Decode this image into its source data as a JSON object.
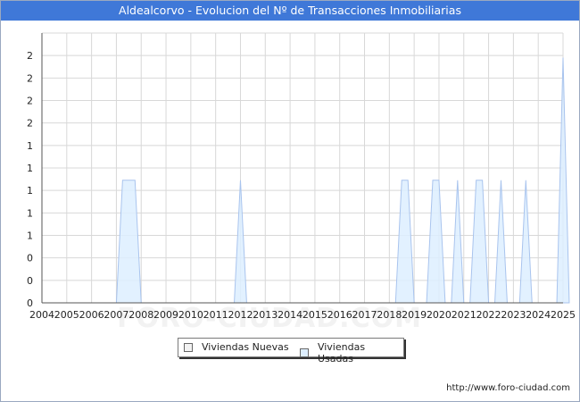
{
  "title": "Aldealcorvo - Evolucion del Nº de Transacciones Inmobiliarias",
  "footer_url": "http://www.foro-ciudad.com",
  "watermark": "FORO-CIUDAD.COM",
  "colors": {
    "title_bg": "#3f78d8",
    "nuevas_fill": "#f2f2f2",
    "usadas_fill": "#ddeeff",
    "usadas_line": "#a9c4ee",
    "grid": "#d8d8d8"
  },
  "chart_data": {
    "type": "area",
    "title": "Aldealcorvo - Evolucion del Nº de Transacciones Inmobiliarias",
    "xlabel": "",
    "ylabel": "",
    "xlim": [
      2004,
      2025
    ],
    "ylim": [
      0,
      2.2
    ],
    "x_ticks": [
      "2004",
      "2005",
      "2006",
      "2007",
      "2008",
      "2009",
      "2010",
      "2011",
      "2012",
      "2013",
      "2014",
      "2015",
      "2016",
      "2017",
      "2018",
      "2019",
      "2020",
      "2021",
      "2022",
      "2023",
      "2024",
      "2025"
    ],
    "y_tick_labels": [
      "0",
      "0",
      "0",
      "1",
      "1",
      "1",
      "1",
      "1",
      "2",
      "2",
      "2",
      "2"
    ],
    "legend_position": "bottom-center",
    "grid": true,
    "series": [
      {
        "name": "Viviendas Nuevas",
        "points": []
      },
      {
        "name": "Viviendas Usadas",
        "points": [
          [
            2007.0,
            0
          ],
          [
            2007.25,
            1
          ],
          [
            2007.75,
            1
          ],
          [
            2008.0,
            0
          ],
          [
            2011.75,
            0
          ],
          [
            2012.0,
            1
          ],
          [
            2012.25,
            0
          ],
          [
            2018.25,
            0
          ],
          [
            2018.5,
            1
          ],
          [
            2018.75,
            1
          ],
          [
            2019.0,
            0
          ],
          [
            2019.5,
            0
          ],
          [
            2019.75,
            1
          ],
          [
            2020.0,
            1
          ],
          [
            2020.25,
            0
          ],
          [
            2020.5,
            0
          ],
          [
            2020.75,
            1
          ],
          [
            2021.0,
            0
          ],
          [
            2021.25,
            0
          ],
          [
            2021.5,
            1
          ],
          [
            2021.75,
            1
          ],
          [
            2022.0,
            0
          ],
          [
            2022.25,
            0
          ],
          [
            2022.5,
            1
          ],
          [
            2022.75,
            0
          ],
          [
            2023.25,
            0
          ],
          [
            2023.5,
            1
          ],
          [
            2023.75,
            0
          ],
          [
            2024.75,
            0
          ],
          [
            2025.0,
            2
          ],
          [
            2025.25,
            0
          ]
        ]
      }
    ]
  }
}
